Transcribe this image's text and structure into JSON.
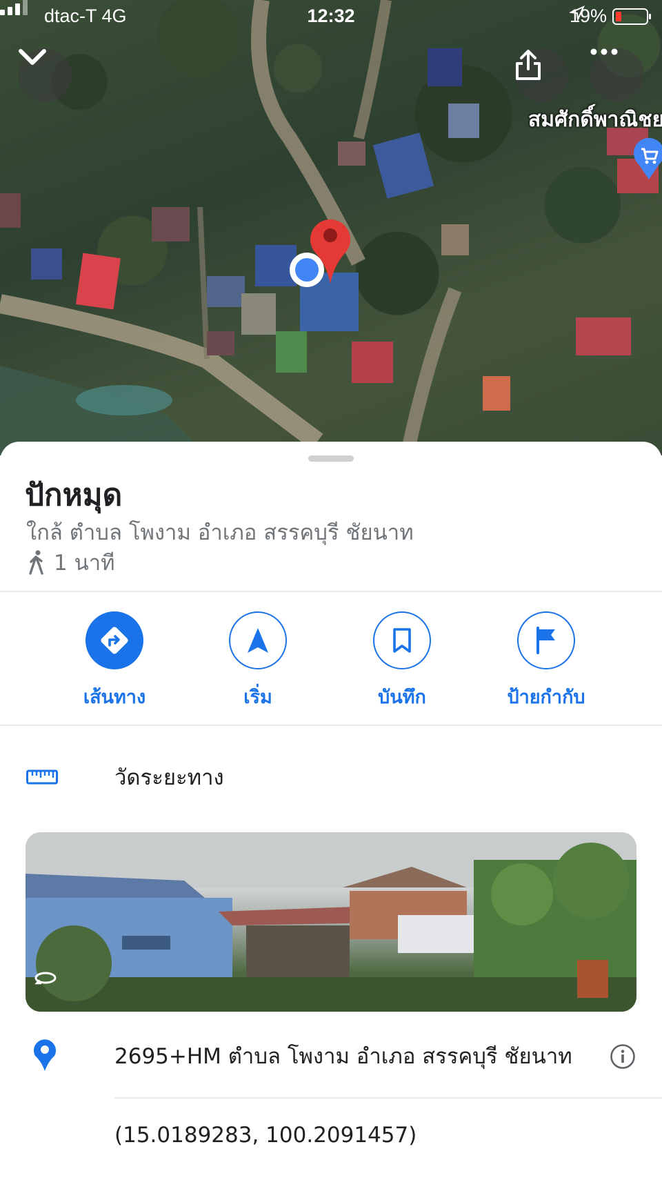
{
  "status_bar": {
    "carrier": "dtac-T  4G",
    "time": "12:32",
    "battery_percent": "19%",
    "battery_level": 0.19
  },
  "map": {
    "poi_label": "สมศักดิ์พาณิชย",
    "icons": [
      "collapse-chevron-icon",
      "share-icon",
      "more-icon",
      "shopping-cart-icon",
      "red-pin-icon",
      "current-location-dot-icon"
    ]
  },
  "place": {
    "title": "ปักหมุด",
    "subtitle": "ใกล้ ตำบล โพงาม อำเภอ สรรคบุรี ชัยนาท",
    "walk_time": "1 นาที"
  },
  "actions": [
    {
      "label": "เส้นทาง",
      "icon": "directions-icon"
    },
    {
      "label": "เริ่ม",
      "icon": "navigation-arrow-icon"
    },
    {
      "label": "บันทึก",
      "icon": "bookmark-icon"
    },
    {
      "label": "ป้ายกำกับ",
      "icon": "flag-icon"
    }
  ],
  "measure": {
    "label": "วัดระยะทาง"
  },
  "address": {
    "plus_code_address": "2695+HM ตำบล โพงาม อำเภอ สรรคบุรี ชัยนาท",
    "coordinates": "(15.0189283, 100.2091457)"
  },
  "colors": {
    "accent": "#1a73e8",
    "pin_red": "#e53935",
    "location_blue": "#4285f4"
  }
}
